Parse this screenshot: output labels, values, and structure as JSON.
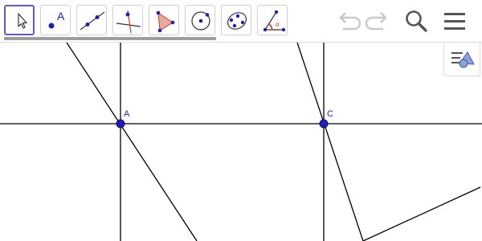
{
  "toolbar": {
    "tools": [
      {
        "icon": "move-arrow-icon",
        "active": true
      },
      {
        "icon": "point-icon",
        "label": "A"
      },
      {
        "icon": "line-icon"
      },
      {
        "icon": "perpendicular-line-icon"
      },
      {
        "icon": "polygon-icon"
      },
      {
        "icon": "circle-center-point-icon"
      },
      {
        "icon": "conic-five-points-icon"
      },
      {
        "icon": "angle-icon",
        "label": "α"
      }
    ],
    "actions": [
      "undo-icon",
      "redo-icon",
      "search-icon",
      "menu-icon"
    ]
  },
  "algebra_toggle": {
    "icon": "algebra-view-icon"
  },
  "graphics": {
    "points": [
      {
        "label": "A",
        "color": "#1f1fb8"
      },
      {
        "label": "C",
        "color": "#1f1fb8"
      }
    ],
    "line_color": "#000000"
  },
  "colors": {
    "accent": "#6557d2",
    "point": "#1f1fb8",
    "polygon_fill": "#e8a8a0"
  }
}
